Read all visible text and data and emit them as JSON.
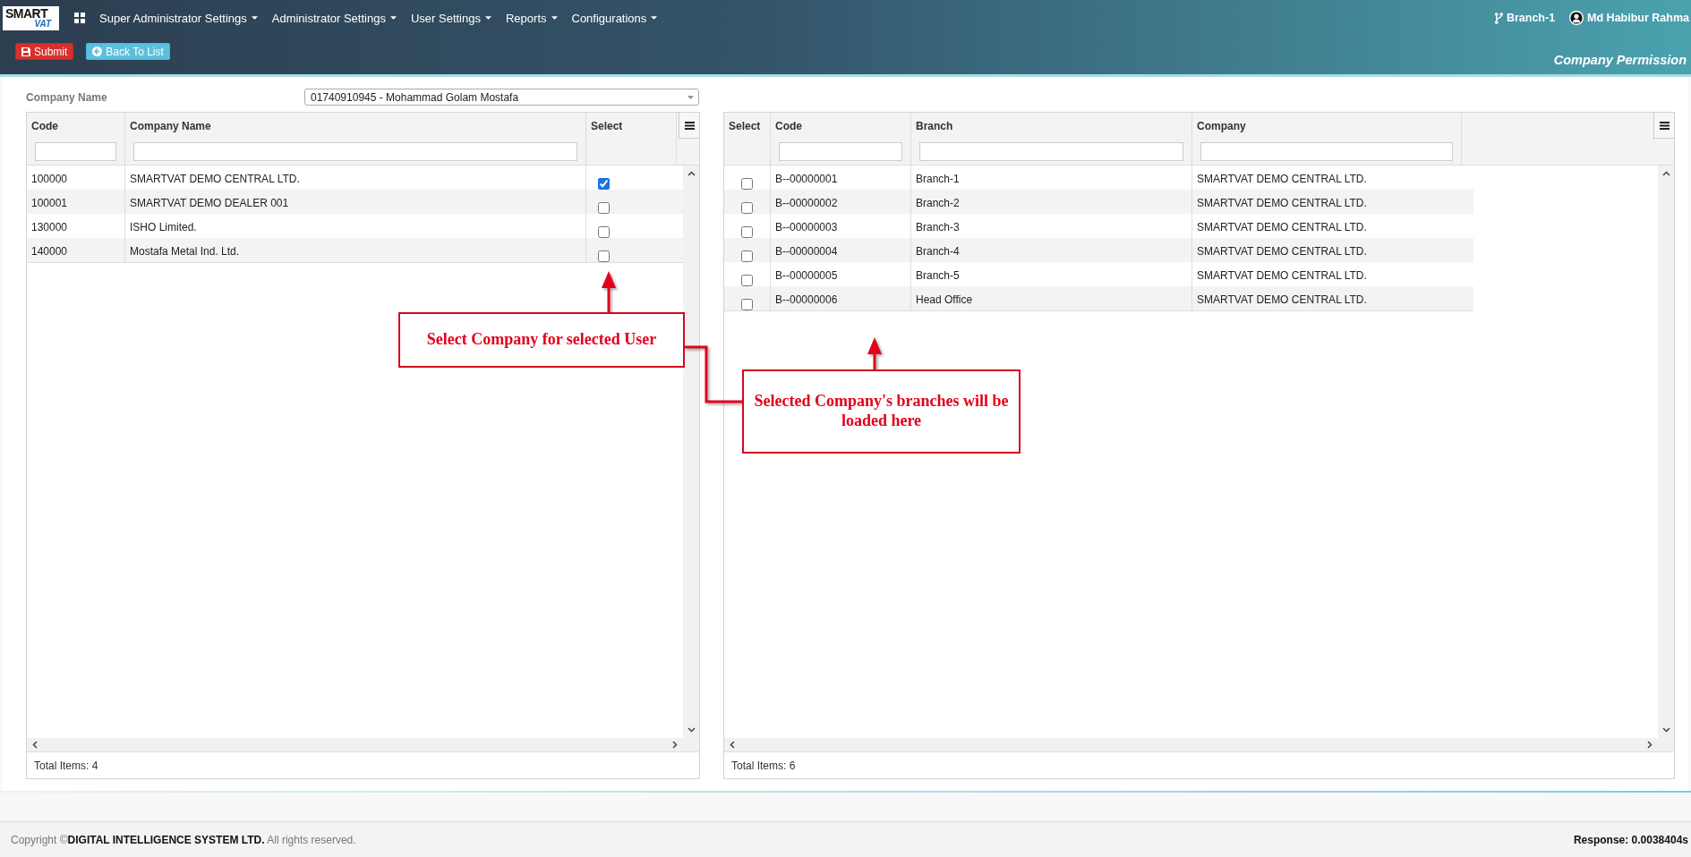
{
  "header": {
    "logo": {
      "top": "SMART",
      "bottom": "VAT"
    },
    "menu": [
      "Super Administrator Settings",
      "Administrator Settings",
      "User Settings",
      "Reports",
      "Configurations"
    ],
    "branch": "Branch-1",
    "user": "Md Habibur Rahma"
  },
  "toolbar": {
    "buttons": [
      {
        "kind": "submit",
        "label": "Submit"
      },
      {
        "kind": "back",
        "label": "Back To List"
      }
    ],
    "title": "Company Permission"
  },
  "filter": {
    "label": "Company Name",
    "value": "01740910945 - Mohammad Golam Mostafa"
  },
  "grids": [
    {
      "columns": [
        {
          "label": "Code",
          "kind": "text"
        },
        {
          "label": "Company Name",
          "kind": "text"
        },
        {
          "label": "Select",
          "kind": "check"
        }
      ],
      "rows": [
        {
          "cells": [
            "100000",
            "SMARTVAT DEMO CENTRAL LTD.",
            {
              "checked": true
            }
          ]
        },
        {
          "cells": [
            "100001",
            "SMARTVAT DEMO DEALER 001",
            {
              "checked": false
            }
          ]
        },
        {
          "cells": [
            "130000",
            "ISHO Limited.",
            {
              "checked": false
            }
          ]
        },
        {
          "cells": [
            "140000",
            "Mostafa Metal Ind. Ltd.",
            {
              "checked": false
            }
          ]
        }
      ],
      "total": "Total Items: 4"
    },
    {
      "columns": [
        {
          "label": "Select",
          "kind": "check"
        },
        {
          "label": "Code",
          "kind": "text"
        },
        {
          "label": "Branch",
          "kind": "text"
        },
        {
          "label": "Company",
          "kind": "text"
        }
      ],
      "rows": [
        {
          "cells": [
            {
              "checked": false
            },
            "B--00000001",
            "Branch-1",
            "SMARTVAT DEMO CENTRAL LTD."
          ]
        },
        {
          "cells": [
            {
              "checked": false
            },
            "B--00000002",
            "Branch-2",
            "SMARTVAT DEMO CENTRAL LTD."
          ]
        },
        {
          "cells": [
            {
              "checked": false
            },
            "B--00000003",
            "Branch-3",
            "SMARTVAT DEMO CENTRAL LTD."
          ]
        },
        {
          "cells": [
            {
              "checked": false
            },
            "B--00000004",
            "Branch-4",
            "SMARTVAT DEMO CENTRAL LTD."
          ]
        },
        {
          "cells": [
            {
              "checked": false
            },
            "B--00000005",
            "Branch-5",
            "SMARTVAT DEMO CENTRAL LTD."
          ]
        },
        {
          "cells": [
            {
              "checked": false
            },
            "B--00000006",
            "Head Office",
            "SMARTVAT DEMO CENTRAL LTD."
          ]
        }
      ],
      "total": "Total Items: 6"
    }
  ],
  "annotations": [
    {
      "text": "Select Company for selected User"
    },
    {
      "text": "Selected Company's branches will be loaded here"
    }
  ],
  "footer": {
    "copyright": "Copyright ©**DIGITAL INTELLIGENCE SYSTEM LTD.** All rights reserved.",
    "response": "Response: 0.0038404s"
  }
}
